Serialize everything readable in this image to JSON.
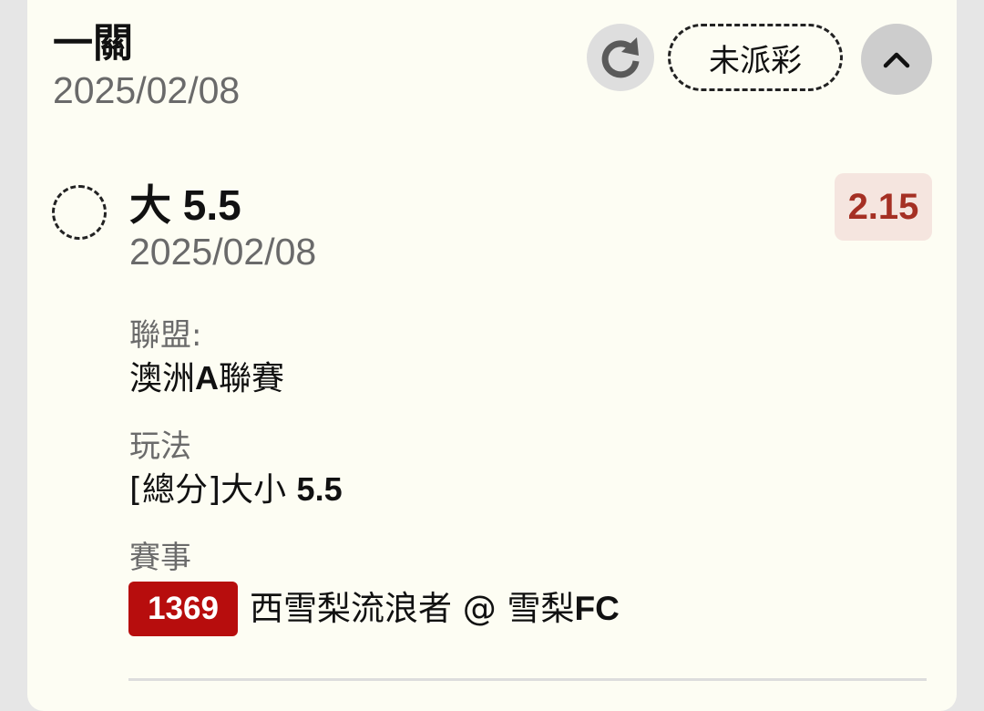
{
  "ticket": {
    "title": "一關",
    "date": "2025/02/08",
    "status_label": "未派彩",
    "icons": {
      "refresh": "refresh-icon",
      "collapse": "chevron-up-icon"
    }
  },
  "selection": {
    "title": "大 5.5",
    "date": "2025/02/08",
    "odds": "2.15",
    "league_label": "聯盟:",
    "league_prefix": "澳洲",
    "league_bold": "A",
    "league_suffix": "聯賽",
    "bet_type_label": "玩法",
    "bet_type_prefix": "[總分]大小 ",
    "bet_type_value": "5.5",
    "match_label": "賽事",
    "match_id": "1369",
    "match_prefix": "西雪梨流浪者 @ 雪梨",
    "match_suffix": "FC"
  },
  "colors": {
    "card_bg": "#fdfdf3",
    "odds_bg": "#f5e5df",
    "odds_text": "#a53024",
    "match_id_bg": "#b70d0d"
  }
}
